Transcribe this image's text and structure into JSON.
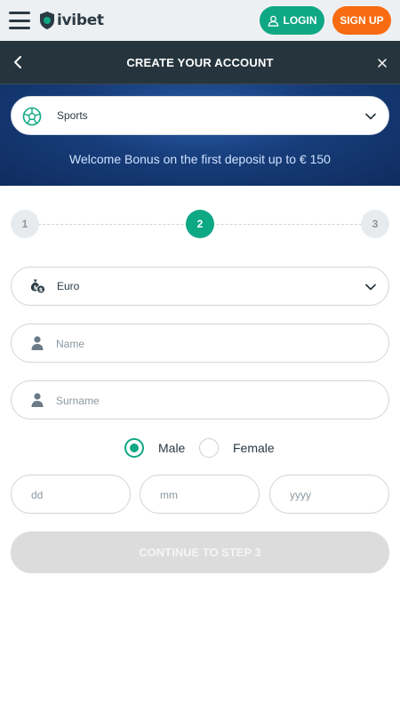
{
  "brand": {
    "name": "ivibet",
    "accent": "#0fa885",
    "signup_color": "#f96b10"
  },
  "topbar": {
    "login_label": "LOGIN",
    "signup_label": "SIGN UP"
  },
  "header": {
    "title": "CREATE YOUR ACCOUNT"
  },
  "bonus": {
    "selected": "Sports",
    "text": "Welcome Bonus on the first deposit up to € 150"
  },
  "steps": {
    "items": [
      "1",
      "2",
      "3"
    ],
    "active_index": 1
  },
  "form": {
    "currency": "Euro",
    "name_placeholder": "Name",
    "surname_placeholder": "Surname",
    "gender_male": "Male",
    "gender_female": "Female",
    "gender_selected": "Male",
    "dd_placeholder": "dd",
    "mm_placeholder": "mm",
    "yyyy_placeholder": "yyyy",
    "continue_label": "CONTINUE TO STEP 3"
  },
  "icons": {
    "menu": "menu-icon",
    "logo": "shield-logo-icon",
    "user": "user-icon",
    "back": "chevron-left-icon",
    "close": "close-icon",
    "sports": "soccer-ball-icon",
    "dropdown": "chevron-down-icon",
    "currency": "money-bag-icon",
    "person": "person-icon"
  }
}
